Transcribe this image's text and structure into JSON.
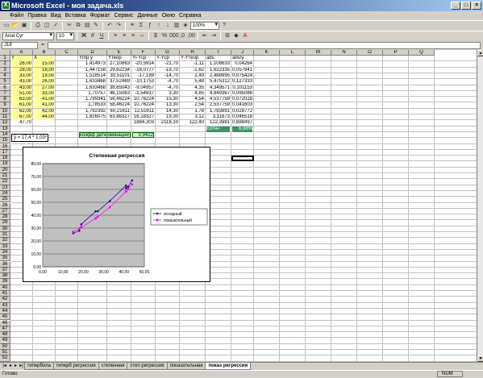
{
  "window": {
    "title": "Microsoft Excel - моя задача.xls"
  },
  "menu": [
    "Файл",
    "Правка",
    "Вид",
    "Вставка",
    "Формат",
    "Сервис",
    "Данные",
    "Окно",
    "Справка"
  ],
  "toolbar": {
    "font": "Arial Cyr",
    "size": "10",
    "zoom": "100%"
  },
  "namebox": "J18",
  "columns": [
    "A",
    "B",
    "C",
    "D",
    "E",
    "F",
    "G",
    "H",
    "I",
    "J",
    "K",
    "L",
    "M",
    "N",
    "O",
    "P",
    "Q"
  ],
  "rows": [
    "1",
    "2",
    "3",
    "4",
    "5",
    "6",
    "7",
    "8",
    "9",
    "10",
    "11",
    "12",
    "13",
    "14",
    "15",
    "16",
    "17",
    "18",
    "19",
    "20",
    "21",
    "22",
    "23",
    "24",
    "25",
    "26",
    "27",
    "28",
    "29",
    "30",
    "31",
    "32",
    "33",
    "34",
    "35",
    "36",
    "37",
    "38",
    "39",
    "40",
    "41",
    "42",
    "43",
    "44",
    "45",
    "46",
    "47",
    "48",
    "49",
    "50",
    "51",
    "52"
  ],
  "headers": {
    "A": "Y",
    "B": "X",
    "D": "Ymp y",
    "E": "Yтеор",
    "F": "Yi-Ycp",
    "G": "Y-Ycp",
    "H": "Y-Yтеор",
    "I": "abs",
    "J": "abs/y"
  },
  "data": [
    [
      "26,00",
      "15,00",
      "1,414973",
      "27,10863",
      "-20,5914",
      "-21,70",
      "-1,11",
      "1,108633",
      "0,04264"
    ],
    [
      "28,00",
      "18,00",
      "1,447158",
      "29,62234",
      "-18,0777",
      "-19,70",
      "-1,62",
      "1,622335",
      "0,057941"
    ],
    [
      "33,00",
      "19,00",
      "1,518514",
      "30,51101",
      "-17,189",
      "-14,70",
      "2,49",
      "2,488995",
      "0,075424"
    ],
    [
      "43,00",
      "26,00",
      "1,633468",
      "37,52469",
      "-10,1753",
      "-4,70",
      "5,48",
      "5,475312",
      "0,127333"
    ],
    [
      "43,00",
      "27,00",
      "1,633468",
      "38,65043",
      "-9,04957",
      "-4,70",
      "4,35",
      "4,349571",
      "0,101153"
    ],
    [
      "51,00",
      "33,00",
      "1,70757",
      "46,15063",
      "-1,54937",
      "3,30",
      "4,85",
      "4,849367",
      "0,095086"
    ],
    [
      "63,00",
      "41,00",
      "1,799341",
      "58,46224",
      "10,76224",
      "15,30",
      "4,54",
      "4,537759",
      "0,072028"
    ],
    [
      "61,00",
      "41,00",
      "1,78533",
      "58,46224",
      "10,76224",
      "13,30",
      "2,54",
      "2,537759",
      "0,041603"
    ],
    [
      "62,00",
      "42,00",
      "1,792392",
      "60,21611",
      "12,51611",
      "14,30",
      "1,78",
      "1,783891",
      "0,028772"
    ],
    [
      "67,00",
      "44,00",
      "1,826075",
      "63,88327",
      "16,18327",
      "19,30",
      "3,12",
      "3,11673",
      "0,046518"
    ]
  ],
  "totals": {
    "A": "47,70",
    "F": "1884,303",
    "G": "2118,10",
    "H": "122,40",
    "I": "122,3981",
    "J": "0,688497"
  },
  "row13": {
    "label": "Еотн=",
    "value": "6,88%"
  },
  "determination": {
    "label": "коэфф детерминации",
    "value": "0,9422"
  },
  "equation": "ŷ = 17,4 * 1,03ˣ",
  "tabs": [
    "гипербола",
    "гиперб регрессия",
    "степенная",
    "степ регрессия",
    "показательная",
    "показ регрессия"
  ],
  "status": {
    "ready": "Готово",
    "num": "NUM"
  },
  "chart_data": {
    "type": "scatter",
    "title": "Степенная регрессия",
    "xlim": [
      0,
      50
    ],
    "ylim": [
      0,
      80
    ],
    "xticks": [
      "0,00",
      "10,00",
      "20,00",
      "30,00",
      "40,00",
      "50,00"
    ],
    "yticks": [
      "0,00",
      "10,00",
      "20,00",
      "30,00",
      "40,00",
      "50,00",
      "60,00",
      "70,00",
      "80,00"
    ],
    "x": [
      15,
      18,
      19,
      26,
      27,
      33,
      41,
      41,
      42,
      44
    ],
    "series": [
      {
        "name": "исходный",
        "color": "#000080",
        "values": [
          26,
          28,
          33,
          43,
          43,
          51,
          63,
          61,
          62,
          67
        ]
      },
      {
        "name": "показательный",
        "color": "#ff00ff",
        "values": [
          27.11,
          29.62,
          30.51,
          37.52,
          38.65,
          46.15,
          58.46,
          58.46,
          60.22,
          63.88
        ]
      }
    ],
    "legend": "right"
  }
}
